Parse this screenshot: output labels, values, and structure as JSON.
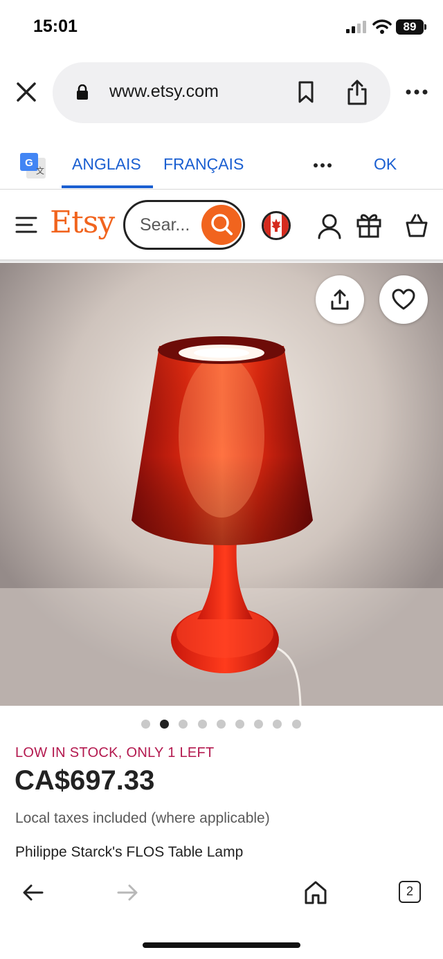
{
  "status_bar": {
    "time": "15:01",
    "battery": "89"
  },
  "browser": {
    "url": "www.etsy.com",
    "icons": [
      "close-icon",
      "lock-icon",
      "bookmark-icon",
      "share-icon",
      "more-icon"
    ]
  },
  "translate_bar": {
    "source_lang": "ANGLAIS",
    "target_lang": "FRANÇAIS",
    "ok_label": "OK"
  },
  "header": {
    "logo": "Etsy",
    "search_placeholder": "Sear...",
    "brand_color": "#f1641e",
    "icons": [
      "menu-icon",
      "search-icon",
      "canada-flag-icon",
      "user-icon",
      "gift-icon",
      "cart-icon"
    ]
  },
  "gallery": {
    "image_count": 9,
    "active_index": 1,
    "icons": [
      "share-icon",
      "heart-icon"
    ]
  },
  "product": {
    "stock_notice": "LOW IN STOCK, ONLY 1 LEFT",
    "price": "CA$697.33",
    "taxes_note": "Local taxes included (where applicable)",
    "title": "Philippe Starck's FLOS Table Lamp",
    "stock_color": "#b3184e"
  },
  "bottom_bar": {
    "tab_count": "2",
    "icons": [
      "back-arrow-icon",
      "forward-arrow-icon",
      "home-icon",
      "tabs-icon"
    ]
  }
}
